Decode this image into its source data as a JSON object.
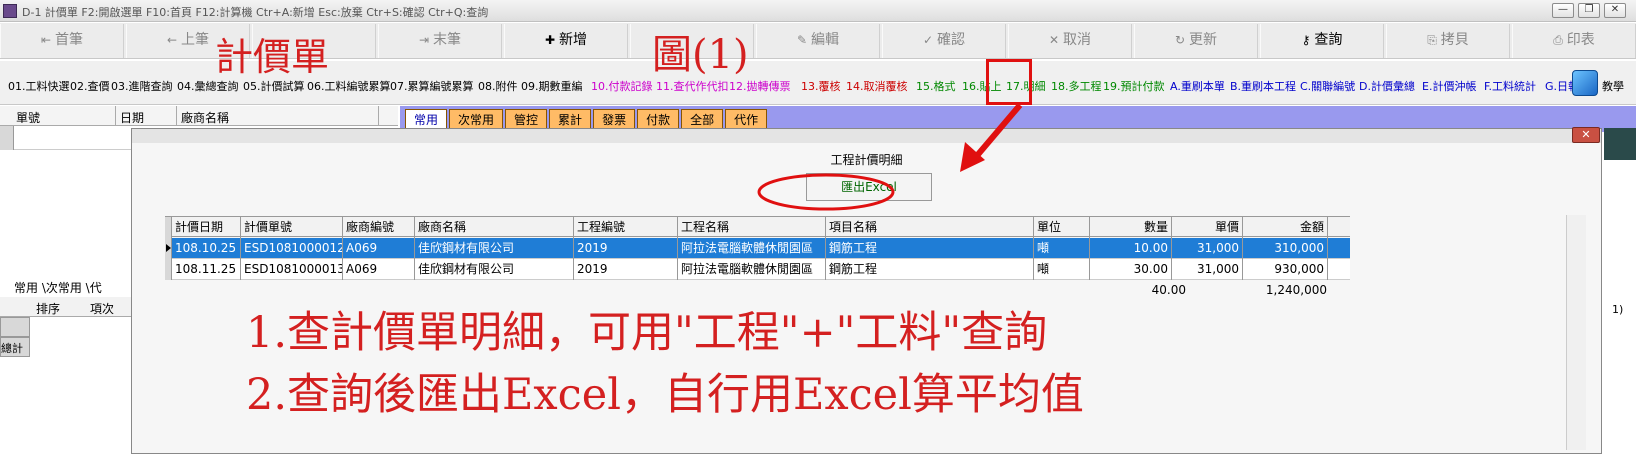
{
  "window": {
    "title": "D-1 計價單   F2:開啟選單  F10:首頁   F12:計算機  Ctr+A:新增  Esc:放棄  Ctr+S:確認  Ctr+Q:查詢"
  },
  "toolbar": {
    "first": "首筆",
    "prev": "上筆",
    "last": "末筆",
    "add": "新增",
    "edit": "編輯",
    "confirm": "確認",
    "cancel": "取消",
    "update": "更新",
    "query": "查詢",
    "copy": "拷貝",
    "print": "印表"
  },
  "menu": {
    "items": [
      "01.工料快選",
      "02.查價",
      "03.進階查詢",
      "04.彙總查詢",
      "05.計價試算",
      "06.工料編號累算",
      "07.累算編號累算",
      "08.附件",
      "09.期數重編",
      "10.付款記錄",
      "11.查代作代扣",
      "12.拋轉傳票",
      "13.覆核",
      "14.取消覆核",
      "15.格式",
      "16.貼上",
      "17.明細",
      "18.多工程",
      "19.預計付款",
      "A.重刷本單",
      "B.重刷本工程",
      "C.關聯編號",
      "D.計價彙總",
      "E.計價沖帳",
      "F.工料統計",
      "G.日報"
    ],
    "help": "教學"
  },
  "left_grid": {
    "headers": [
      "單號",
      "日期",
      "廠商名稱"
    ]
  },
  "left_tabs": "常用 \\次常用 \\代",
  "left_grid2": {
    "headers": [
      "排序",
      "項次"
    ],
    "total_label": "總計"
  },
  "tabs": [
    "常用",
    "次常用",
    "管控",
    "累計",
    "發票",
    "付款",
    "全部",
    "代作"
  ],
  "dialog": {
    "title": "工程計價明細",
    "export_button": "匯出Excel",
    "close": "✕"
  },
  "detail_table": {
    "headers": [
      "計價日期",
      "計價單號",
      "廠商編號",
      "廠商名稱",
      "工程編號",
      "工程名稱",
      "項目名稱",
      "單位",
      "數量",
      "單價",
      "金額"
    ],
    "rows": [
      [
        "108.10.25",
        "ESD1081000012",
        "A069",
        "佳欣鋼材有限公司",
        "2019",
        "阿拉法電腦軟體休閒園區",
        "鋼筋工程",
        "噸",
        "10.00",
        "31,000",
        "310,000"
      ],
      [
        "108.11.25",
        "ESD1081000013",
        "A069",
        "佳欣鋼材有限公司",
        "2019",
        "阿拉法電腦軟體休閒園區",
        "鋼筋工程",
        "噸",
        "30.00",
        "31,000",
        "930,000"
      ]
    ],
    "total_qty": "40.00",
    "total_amount": "1,240,000"
  },
  "annotations": {
    "title": "計價單",
    "figure": "圖(1)",
    "line1": "1.查計價單明細，可用\"工程\"+\"工料\"查詢",
    "line2": "2.查詢後匯出Excel，自行用Excel算平均值"
  },
  "right_edge": "1)",
  "colors": {
    "annotation_red": "#d42020",
    "selected_row": "#1f7dd6",
    "tab_orange": "#ffbb66",
    "tab_strip": "#9999ee"
  }
}
